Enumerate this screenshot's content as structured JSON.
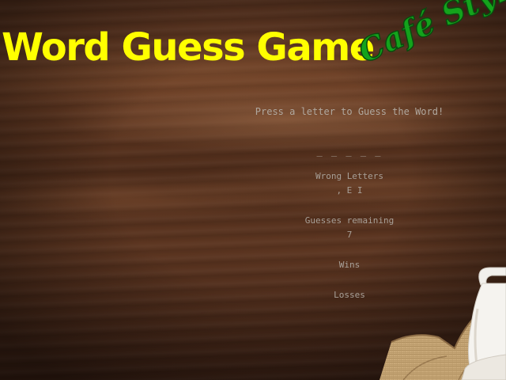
{
  "header": {
    "title": "Word Guess Game",
    "subtitle": "Café Style"
  },
  "game": {
    "instructions": "Press a letter to Guess the Word!",
    "current_word": "_ _ _ _ _",
    "wrong_letters_label": "Wrong Letters",
    "wrong_letters_value": ", E I",
    "guesses_remaining_label": "Guesses remaining",
    "guesses_remaining_value": "7",
    "wins_label": "Wins",
    "losses_label": "Losses"
  },
  "colors": {
    "title": "#ffff00",
    "subtitle": "#14a31c",
    "game_text": "#a8a098",
    "background": "#5a3420"
  }
}
